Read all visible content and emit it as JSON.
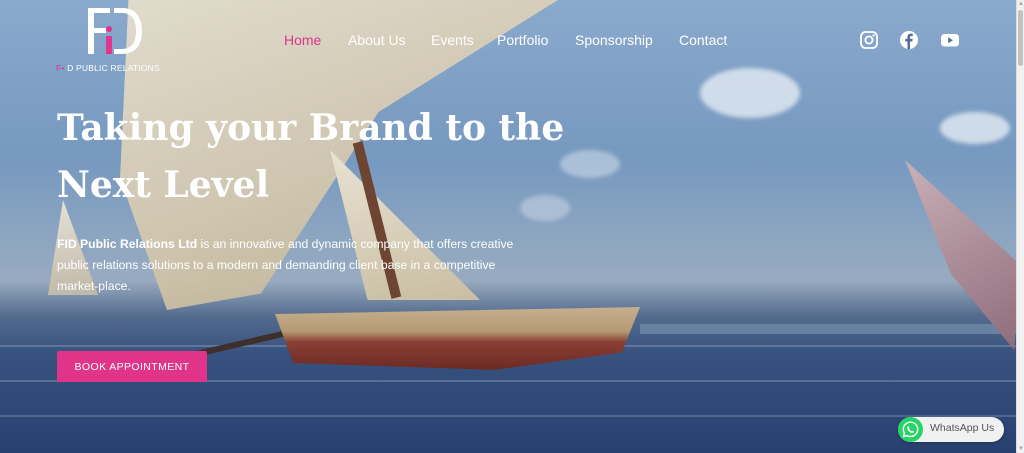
{
  "brand": {
    "logo_mark": "FiD",
    "name_prefix": "F",
    "name_dash": "•",
    "name_suffix": " D PUBLIC RELATIONS",
    "accent_color": "#e0348d"
  },
  "nav": {
    "items": [
      {
        "label": "Home",
        "active": true
      },
      {
        "label": "About Us",
        "active": false
      },
      {
        "label": "Events",
        "active": false
      },
      {
        "label": "Portfolio",
        "active": false
      },
      {
        "label": "Sponsorship",
        "active": false
      },
      {
        "label": "Contact",
        "active": false
      }
    ]
  },
  "social": {
    "icons": [
      "instagram-icon",
      "facebook-icon",
      "youtube-icon"
    ]
  },
  "hero": {
    "headline_line1": "Taking your Brand to the",
    "headline_line2": "Next Level",
    "company_bold": "FID Public Relations Ltd",
    "description": " is an innovative and dynamic company that offers creative public relations solutions to a modern and demanding client base in a competitive market-place.",
    "cta_label": "BOOK APPOINTMENT",
    "cta_color": "#e03489"
  },
  "whatsapp": {
    "label": "WhatsApp Us",
    "icon": "whatsapp-icon",
    "color": "#25d366"
  }
}
